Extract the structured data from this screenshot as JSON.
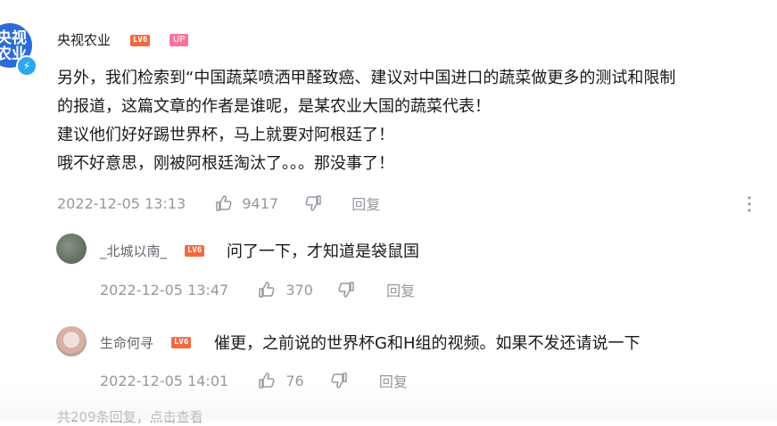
{
  "main_comment": {
    "avatar_text": [
      "央视",
      "农业"
    ],
    "username": "央视农业",
    "level_badge": "LV6",
    "up_badge": "UP",
    "lines": [
      "另外，我们检索到“中国蔬菜喷洒甲醛致癌、建议对中国进口的蔬菜做更多的测试和限制",
      "的报道，这篇文章的作者是谁呢，是某农业大国的蔬菜代表！",
      "建议他们好好踢世界杯，马上就要对阿根廷了！",
      "哦不好意思，刚被阿根廷淘汰了。。。那没事了！"
    ],
    "timestamp": "2022-12-05 13:13",
    "likes": "9417",
    "reply_label": "回复"
  },
  "replies": [
    {
      "username": "_北城以南_",
      "level_badge": "LV6",
      "text": "问了一下，才知道是袋鼠国",
      "timestamp": "2022-12-05 13:47",
      "likes": "370",
      "reply_label": "回复"
    },
    {
      "username": "生命何寻",
      "level_badge": "LV6",
      "text": "催更，之前说的世界杯G和H组的视频。如果不发还请说一下",
      "timestamp": "2022-12-05 14:01",
      "likes": "76",
      "reply_label": "回复"
    }
  ],
  "footer": {
    "replies_summary": "共209条回复，点击查看"
  },
  "colors": {
    "level_badge": "#f36a40",
    "up_badge": "#fb7299",
    "verified": "#2fa7f0",
    "meta_text": "#9499a0"
  },
  "icons": [
    "thumbs-up-icon",
    "thumbs-down-icon",
    "more-vertical-icon",
    "verified-icon"
  ]
}
